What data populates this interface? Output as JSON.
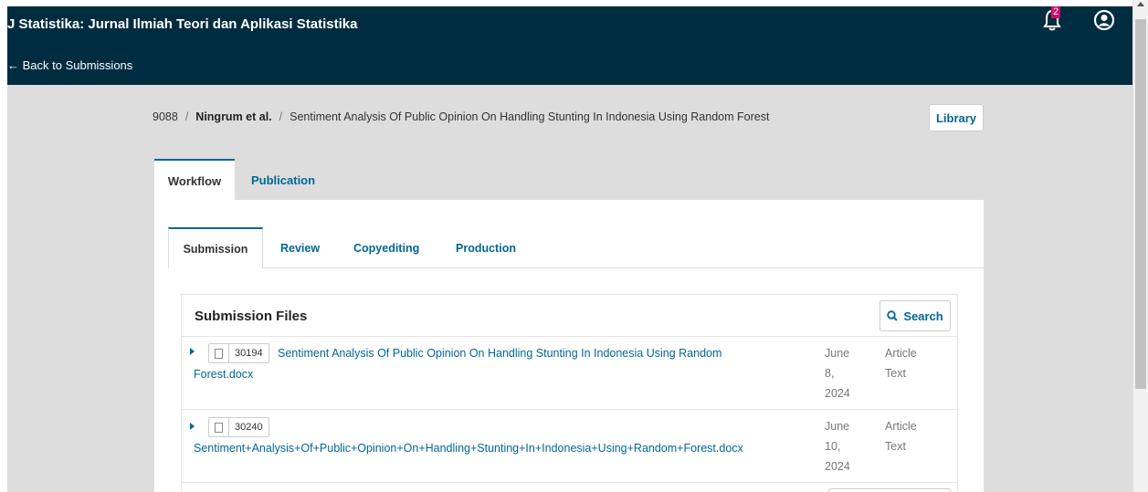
{
  "header": {
    "journal_title": "J Statistika: Jurnal Ilmiah Teori dan Aplikasi Statistika",
    "back_link": "← Back to Submissions",
    "notifications_count": "2",
    "bell_icon": "notification-bell-icon",
    "user_icon": "user-profile-icon",
    "bg_color": "#002c40"
  },
  "breadcrumb": {
    "id": "9088",
    "author": "Ningrum et al.",
    "title": "Sentiment Analysis Of Public Opinion On Handling Stunting In Indonesia Using Random Forest",
    "separator": "/"
  },
  "library_button": "Library",
  "main_tabs": [
    {
      "label": "Workflow",
      "active": true
    },
    {
      "label": "Publication",
      "active": false
    }
  ],
  "sub_tabs": [
    {
      "label": "Submission",
      "active": true
    },
    {
      "label": "Review",
      "active": false
    },
    {
      "label": "Copyediting",
      "active": false
    },
    {
      "label": "Production",
      "active": false
    }
  ],
  "submission_files": {
    "title": "Submission Files",
    "search_button": "Search",
    "files": [
      {
        "id": "30194",
        "name_line1": "Sentiment Analysis Of Public Opinion On Handling Stunting In Indonesia Using Random",
        "name_line2": "Forest.docx",
        "date_line1": "June",
        "date_line2": "8,",
        "date_line3": "2024",
        "type_line1": "Article",
        "type_line2": "Text"
      },
      {
        "id": "30240",
        "name_line1": "",
        "name_line2": "Sentiment+Analysis+Of+Public+Opinion+On+Handling+Stunting+In+Indonesia+Using+Random+Forest.docx",
        "date_line1": "June",
        "date_line2": "10,",
        "date_line3": "2024",
        "type_line1": "Article",
        "type_line2": "Text"
      }
    ]
  },
  "colors": {
    "accent": "#006798",
    "badge": "#d00a6c"
  }
}
